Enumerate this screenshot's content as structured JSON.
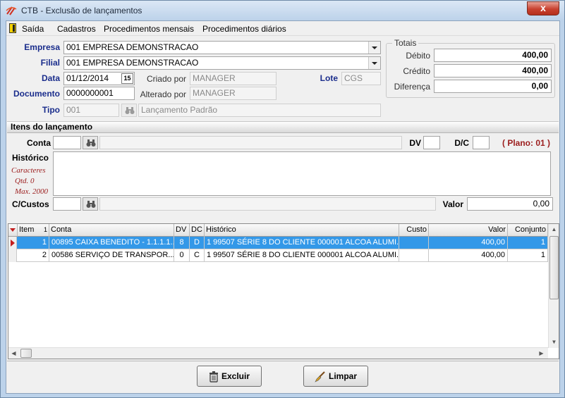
{
  "window": {
    "title": "CTB - Exclusão de lançamentos",
    "close_glyph": "x",
    "title_icon": "swirl-logo-icon",
    "accent_color": "#bcd2ea"
  },
  "menu": {
    "exit": "Saída",
    "cadastros": "Cadastros",
    "proc_mensais": "Procedimentos mensais",
    "proc_diarios": "Procedimentos diários"
  },
  "header": {
    "empresa_label": "Empresa",
    "empresa_value": "001 EMPRESA DEMONSTRACAO",
    "filial_label": "Filial",
    "filial_value": "001 EMPRESA DEMONSTRACAO",
    "data_label": "Data",
    "data_value": "01/12/2014",
    "calendar_glyph": "15",
    "criado_label": "Criado por",
    "criado_value": "MANAGER",
    "lote_label": "Lote",
    "lote_value": "CGS",
    "documento_label": "Documento",
    "documento_value": "0000000001",
    "alterado_label": "Alterado por",
    "alterado_value": "MANAGER",
    "tipo_label": "Tipo",
    "tipo_code": "001",
    "tipo_desc": "Lançamento Padrão"
  },
  "totais": {
    "title": "Totais",
    "debito_label": "Débito",
    "debito_value": "400,00",
    "credito_label": "Crédito",
    "credito_value": "400,00",
    "diferenca_label": "Diferença",
    "diferenca_value": "0,00"
  },
  "itens": {
    "section_title": "Itens do lançamento",
    "conta_label": "Conta",
    "dv_label": "DV",
    "dc_label": "D/C",
    "plano_text": "( Plano: 01 )",
    "historico_label": "Histórico",
    "caracteres_label": "Caracteres",
    "qtd_label": "Qtd. 0",
    "max_label": "Max. 2000",
    "ccustos_label": "C/Custos",
    "valor_label": "Valor",
    "valor_value": "0,00"
  },
  "grid": {
    "columns": [
      "Item",
      "Conta",
      "DV",
      "DC",
      "Histórico",
      "Custo",
      "Valor",
      "Conjunto"
    ],
    "sort_glyph": "1",
    "rows": [
      {
        "item": "1",
        "conta": "00895 CAIXA BENEDITO - 1.1.1.1...",
        "dv": "8",
        "dc": "D",
        "historico": "1 99507 SÉRIE 8 DO CLIENTE 000001 ALCOA ALUMI...",
        "custo": "",
        "valor": "400,00",
        "conjunto": "1",
        "selected": true
      },
      {
        "item": "2",
        "conta": "00586 SERVIÇO DE TRANSPOR...",
        "dv": "0",
        "dc": "C",
        "historico": "1 99507 SÉRIE 8 DO CLIENTE 000001 ALCOA ALUMI...",
        "custo": "",
        "valor": "400,00",
        "conjunto": "1",
        "selected": false
      }
    ],
    "selected_color": "#3398e8"
  },
  "buttons": {
    "excluir": "Excluir",
    "limpar": "Limpar"
  }
}
